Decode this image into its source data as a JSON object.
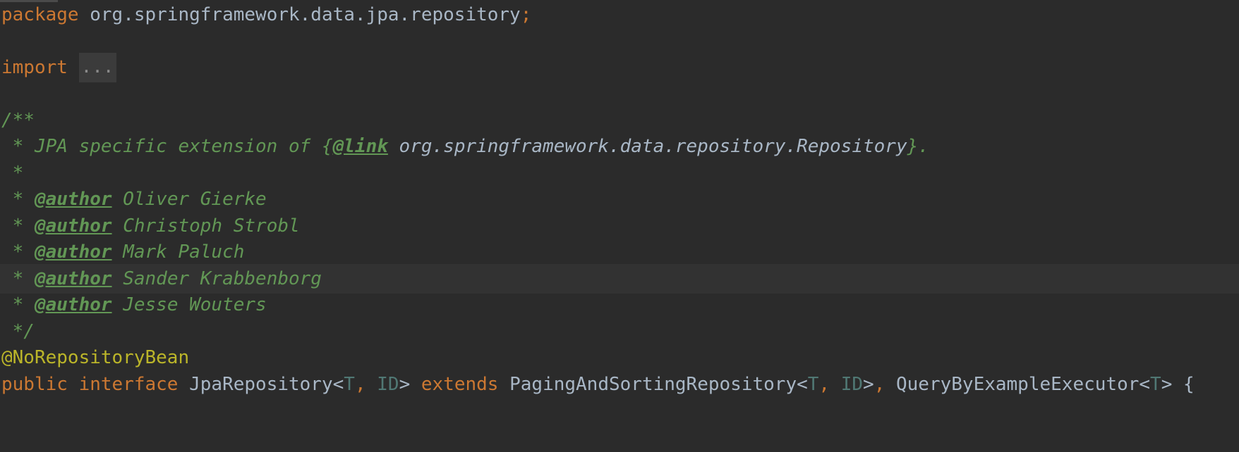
{
  "package_line": {
    "keyword": "package",
    "name": "org.springframework.data.jpa.repository",
    "semicolon": ";"
  },
  "import_line": {
    "keyword": "import",
    "fold": "..."
  },
  "javadoc": {
    "open": "/**",
    "desc_prefix": " * JPA specific extension of {",
    "link_tag": "@link",
    "link_ref": "org.springframework.data.repository.Repository",
    "desc_suffix": "}.",
    "blank": " *",
    "author_prefix": " * ",
    "author_tag": "@author",
    "authors": [
      "Oliver Gierke",
      "Christoph Strobl",
      "Mark Paluch",
      "Sander Krabbenborg",
      "Jesse Wouters"
    ],
    "close": " */"
  },
  "annotation": "@NoRepositoryBean",
  "declaration": {
    "public": "public",
    "interface": "interface",
    "name": "JpaRepository<",
    "t": "T",
    "comma1": ", ",
    "id": "ID",
    "gt1": "> ",
    "extends": "extends",
    "super1": " PagingAndSortingRepository<",
    "t2": "T",
    "comma2": ", ",
    "id2": "ID",
    "gt2": ">",
    "comma3": ", ",
    "super2": "QueryByExampleExecutor<",
    "t3": "T",
    "gt3": "> {"
  }
}
